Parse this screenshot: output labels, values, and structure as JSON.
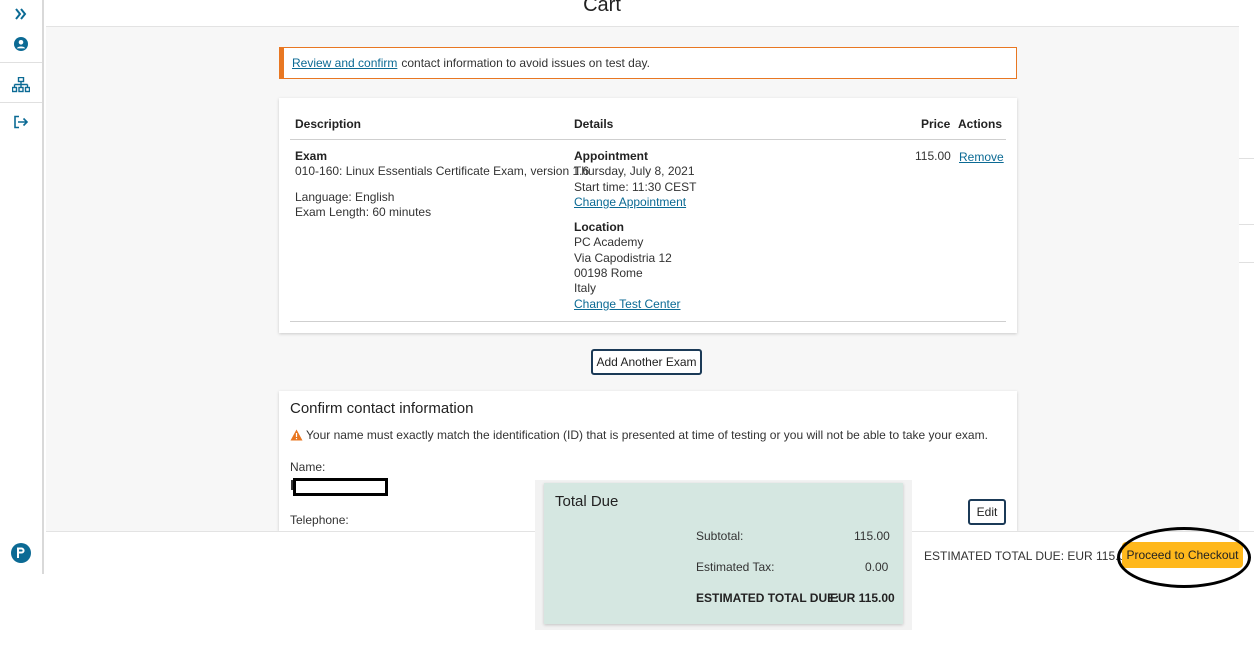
{
  "page": {
    "title": "Cart"
  },
  "sidebar": {
    "icons": [
      "chevrons-right-icon",
      "user-icon",
      "sitemap-icon",
      "sign-out-icon",
      "pearson-logo-icon"
    ]
  },
  "alert": {
    "link_text": "Review and confirm",
    "text": "contact information to avoid issues on test day."
  },
  "cart_table": {
    "headers": {
      "description": "Description",
      "details": "Details",
      "price": "Price",
      "actions": "Actions"
    },
    "row": {
      "description": {
        "type": "Exam",
        "name": "010-160: Linux Essentials Certificate Exam, version 1.6",
        "language": "Language: English",
        "length": "Exam Length: 60 minutes"
      },
      "appointment": {
        "heading": "Appointment",
        "date": "Thursday, July 8, 2021",
        "start_time": "Start time: 11:30 CEST",
        "change_link": "Change Appointment"
      },
      "location": {
        "heading": "Location",
        "name": "PC Academy",
        "street": "Via Capodistria 12",
        "city": "00198 Rome",
        "country": "Italy",
        "change_link": "Change Test Center"
      },
      "price": "115.00",
      "remove_link": "Remove"
    }
  },
  "add_exam_button": "Add Another Exam",
  "contact": {
    "title": "Confirm contact information",
    "warning": "Your name must exactly match the identification (ID) that is presented at time of testing or you will not be able to take your exam.",
    "name_label": "Name:",
    "telephone_label": "Telephone:",
    "edit_button": "Edit"
  },
  "total_due": {
    "title": "Total Due",
    "subtotal_label": "Subtotal:",
    "subtotal_value": "115.00",
    "tax_label": "Estimated Tax:",
    "tax_value": "0.00",
    "estimated_label": "ESTIMATED TOTAL DUE:",
    "estimated_value": "EUR 115.00"
  },
  "footer": {
    "estimated_total": "ESTIMATED TOTAL DUE: EUR 115.00",
    "checkout_button": "Proceed to Checkout"
  },
  "colors": {
    "link": "#0b6a94",
    "alert_border": "#e87722",
    "checkout": "#ffb81c",
    "total_panel": "#d5e7e1",
    "navy_button_border": "#1b3a57"
  }
}
